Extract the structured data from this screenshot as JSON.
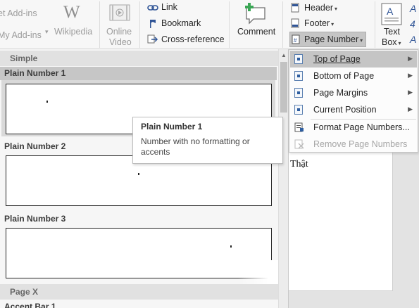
{
  "ribbon": {
    "addins_label": "et Add-ins",
    "myaddins_label": "My Add-ins",
    "wikipedia_label": "Wikipedia",
    "online_video_line1": "Online",
    "online_video_line2": "Video",
    "link_label": "Link",
    "bookmark_label": "Bookmark",
    "crossref_label": "Cross-reference",
    "comment_label": "Comment",
    "header_label": "Header",
    "footer_label": "Footer",
    "page_number_label": "Page Number",
    "textbox_line1": "Text",
    "textbox_line2": "Box"
  },
  "gallery": {
    "category_simple": "Simple",
    "items": [
      {
        "label": "Plain Number 1"
      },
      {
        "label": "Plain Number 2"
      },
      {
        "label": "Plain Number 3"
      }
    ],
    "category_pagex": "Page X",
    "next_item_label": "Accent Bar 1"
  },
  "tooltip": {
    "title": "Plain Number 1",
    "body": "Number with no formatting or accents"
  },
  "menu": {
    "items": [
      {
        "label": "Top of Page",
        "icon": "page-number-icon",
        "submenu": true
      },
      {
        "label": "Bottom of Page",
        "icon": "page-number-icon",
        "submenu": true
      },
      {
        "label": "Page Margins",
        "icon": "page-number-icon",
        "submenu": true
      },
      {
        "label": "Current Position",
        "icon": "page-number-icon",
        "submenu": true
      },
      {
        "label": "Format Page Numbers...",
        "icon": "format-page-numbers-icon",
        "submenu": false
      },
      {
        "label": "Remove Page Numbers",
        "icon": "remove-page-numbers-icon",
        "submenu": false,
        "disabled": true
      }
    ],
    "arrow_glyph": "▶"
  },
  "document": {
    "visible_text": "Thật",
    "fragment": "g"
  },
  "colors": {
    "highlight": "#c5c5c5",
    "ribbon_bg": "#f7f7f7",
    "link_icon": "#2f5496",
    "comment_plus": "#3aa655"
  }
}
